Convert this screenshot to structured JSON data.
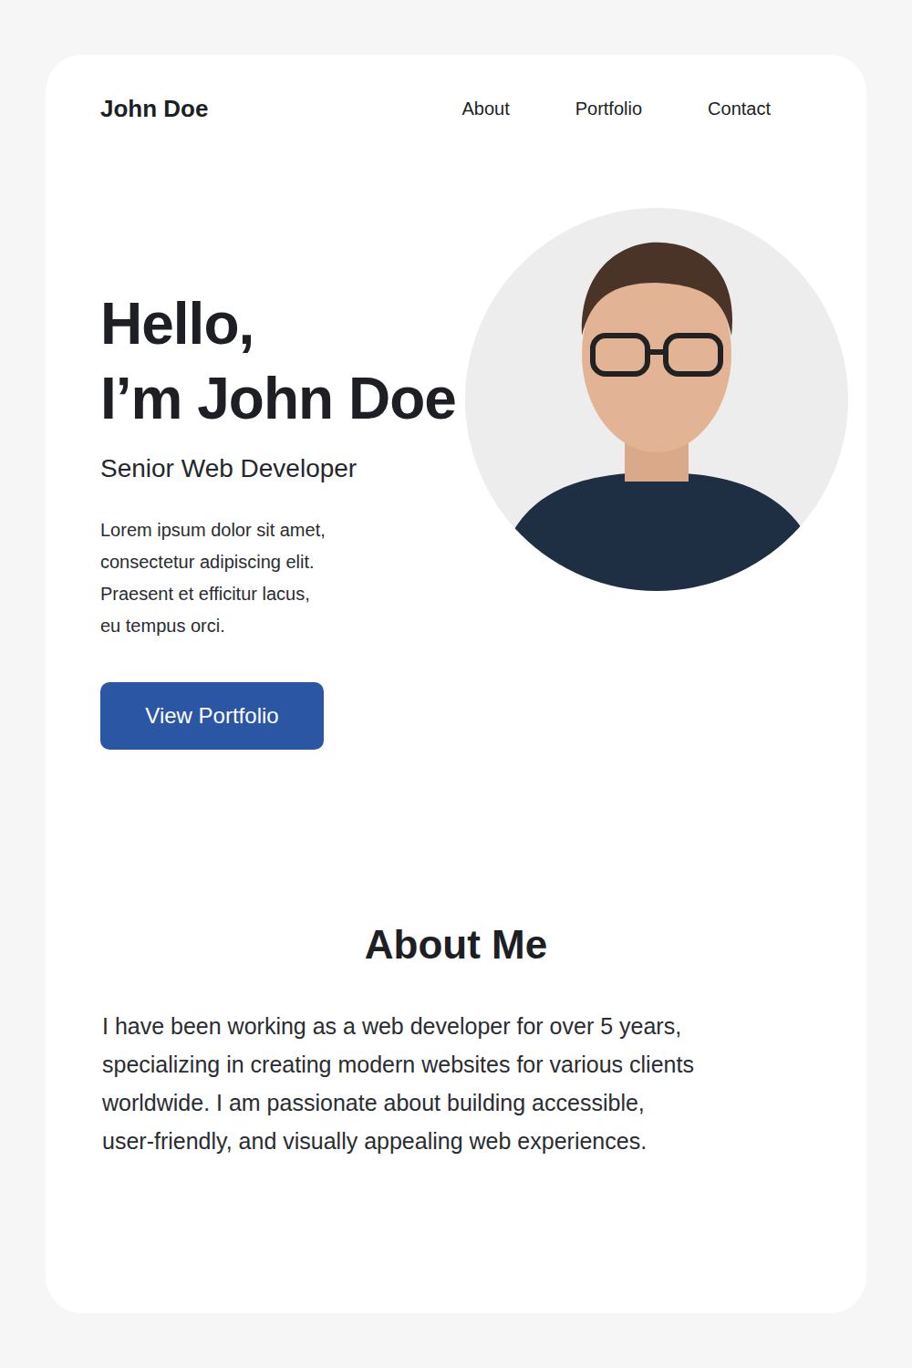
{
  "header": {
    "brand": "John Doe",
    "nav": [
      {
        "label": "About"
      },
      {
        "label": "Portfolio"
      },
      {
        "label": "Contact"
      }
    ]
  },
  "hero": {
    "greeting": "Hello,",
    "headline": "I’m John Doe",
    "title": "Senior Web Developer",
    "intro": [
      "Lorem ipsum dolor sit amet,",
      "consectetur adipiscing elit.",
      "Praesent et efficitur lacus,",
      "eu tempus orci."
    ],
    "button": "View Portfolio"
  },
  "about": {
    "heading": "About Me",
    "body": [
      "I have been working as a web developer for over 5 years,",
      "specializing in creating modern websites for various clients",
      "worldwide. I am passionate about building accessible,",
      "user-friendly, and visually appealing web experiences."
    ]
  }
}
